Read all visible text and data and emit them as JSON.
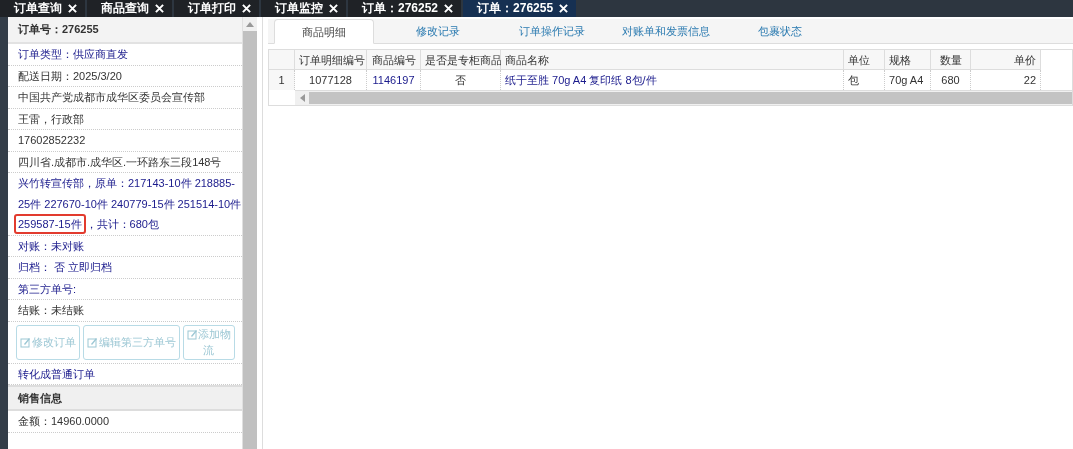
{
  "top_tabs": [
    {
      "label": "订单查询",
      "selected": false
    },
    {
      "label": "商品查询",
      "selected": false
    },
    {
      "label": "订单打印",
      "selected": false
    },
    {
      "label": "订单监控",
      "selected": false
    },
    {
      "label": "订单：276252",
      "selected": false
    },
    {
      "label": "订单：276255",
      "selected": true
    }
  ],
  "order_panel": {
    "title": "订单号：276255",
    "rows": [
      {
        "kind": "link",
        "text": "订单类型：供应商直发"
      },
      {
        "kind": "text",
        "text": "配送日期：2025/3/20"
      },
      {
        "kind": "text",
        "text": "中国共产党成都市成华区委员会宣传部"
      },
      {
        "kind": "text",
        "text": "王雷，行政部"
      },
      {
        "kind": "text",
        "text": "17602852232"
      },
      {
        "kind": "text",
        "text": "四川省.成都市.成华区.一环路东三段148号"
      },
      {
        "kind": "note",
        "lines": [
          [
            {
              "text": "兴竹转宣传部，原单：217143-10件 218885-",
              "highlighted": false
            }
          ],
          [
            {
              "text": "25件 227670-10件 240779-15件 251514-10件",
              "highlighted": false
            }
          ],
          [
            {
              "text": "259587-15件",
              "highlighted": true
            },
            {
              "text": "，共计：680包",
              "highlighted": false
            }
          ]
        ]
      },
      {
        "kind": "link",
        "text": "对账：未对账"
      },
      {
        "kind": "link",
        "text": "归档： 否 立即归档"
      },
      {
        "kind": "link",
        "text": "第三方单号:"
      },
      {
        "kind": "text",
        "text": "结账：未结账"
      },
      {
        "kind": "buttons",
        "buttons": [
          {
            "label": "修改订单",
            "disabled": true
          },
          {
            "label": "编辑第三方单号",
            "disabled": true
          },
          {
            "label": "添加物流",
            "disabled": true
          }
        ]
      },
      {
        "kind": "link",
        "text": "转化成普通订单"
      },
      {
        "kind": "section",
        "text": "销售信息"
      },
      {
        "kind": "text",
        "text": "金额：14960.0000"
      }
    ]
  },
  "detail_tabs": [
    {
      "label": "商品明细",
      "selected": true
    },
    {
      "label": "修改记录",
      "selected": false
    },
    {
      "label": "订单操作记录",
      "selected": false
    },
    {
      "label": "对账单和发票信息",
      "selected": false
    },
    {
      "label": "包裹状态",
      "selected": false
    }
  ],
  "table": {
    "columns": [
      "订单明细编号",
      "商品编号",
      "是否是专柜商品",
      "商品名称",
      "单位",
      "规格",
      "数量",
      "单价"
    ],
    "rows": [
      {
        "row_number": "1",
        "cells": [
          "1077128",
          "1146197",
          "否",
          "纸于至胜 70g A4 复印纸 8包/件",
          "包",
          "70g A4",
          "680",
          "22"
        ]
      }
    ]
  }
}
